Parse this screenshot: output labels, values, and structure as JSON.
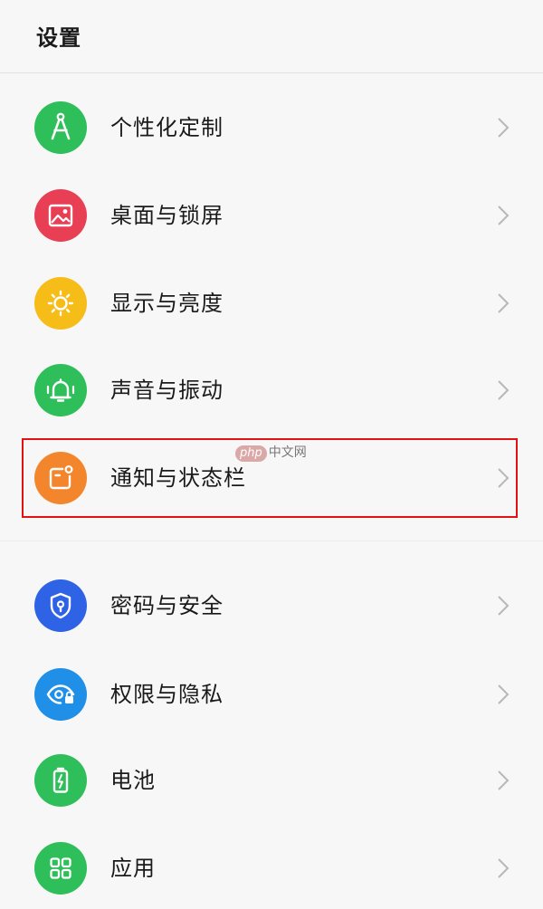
{
  "header": {
    "title": "设置"
  },
  "settings": {
    "items": [
      {
        "label": "个性化定制",
        "icon": "compass-icon",
        "color": "#2fbf5a"
      },
      {
        "label": "桌面与锁屏",
        "icon": "image-icon",
        "color": "#e83f55"
      },
      {
        "label": "显示与亮度",
        "icon": "sun-icon",
        "color": "#f6bc18"
      },
      {
        "label": "声音与振动",
        "icon": "bell-icon",
        "color": "#2fbf5a"
      },
      {
        "label": "通知与状态栏",
        "icon": "notification-icon",
        "color": "#f3862c",
        "highlighted": true
      },
      {
        "label": "密码与安全",
        "icon": "shield-lock-icon",
        "color": "#2f63e6"
      },
      {
        "label": "权限与隐私",
        "icon": "eye-lock-icon",
        "color": "#1f8fe8"
      },
      {
        "label": "电池",
        "icon": "battery-icon",
        "color": "#2fbf5a"
      },
      {
        "label": "应用",
        "icon": "apps-grid-icon",
        "color": "#2fbf5a"
      }
    ]
  },
  "watermark": {
    "badge": "php",
    "text": "中文网"
  },
  "highlight_color": "#e01212"
}
